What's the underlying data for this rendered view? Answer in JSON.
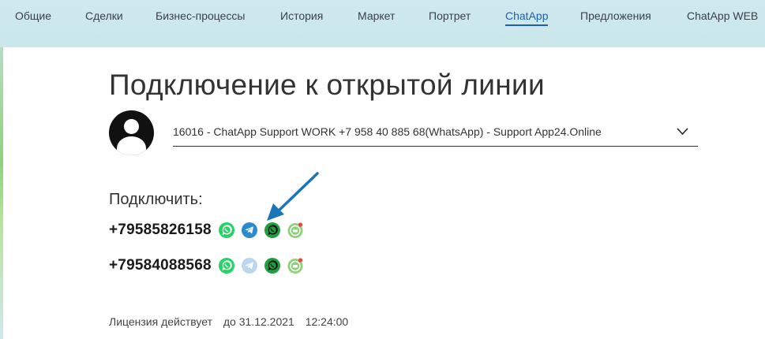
{
  "tabs": [
    {
      "label": "Общие",
      "active": false
    },
    {
      "label": "Сделки",
      "active": false
    },
    {
      "label": "Бизнес-процессы",
      "active": false
    },
    {
      "label": "История",
      "active": false
    },
    {
      "label": "Маркет",
      "active": false
    },
    {
      "label": "Портрет",
      "active": false
    },
    {
      "label": "ChatApp",
      "active": true
    },
    {
      "label": "Предложения",
      "active": false
    },
    {
      "label": "ChatApp WEB",
      "active": false
    }
  ],
  "page": {
    "title": "Подключение к открытой линии"
  },
  "line_select": {
    "value": "16016 - ChatApp Support WORK +7 958 40 885 68(WhatsApp) - Support App24.Online"
  },
  "connect": {
    "label": "Подключить:",
    "rows": [
      {
        "phone": "+79585826158"
      },
      {
        "phone": "+79584088568"
      }
    ]
  },
  "license": {
    "label": "Лицензия действует",
    "until": "до 31.12.2021",
    "time": "12:24:00"
  },
  "colors": {
    "accent": "#1d5fb0",
    "whatsapp": "#25d366",
    "telegram": "#2a8bd1",
    "telegram_light": "#b9d7ee",
    "whatsapp_dark": "#1f9d3f",
    "arrow": "#1b75bb"
  },
  "icons": [
    "whatsapp-icon",
    "telegram-icon",
    "whatsapp-business-icon",
    "avito-icon",
    "chevron-down-icon",
    "user-avatar-icon"
  ]
}
